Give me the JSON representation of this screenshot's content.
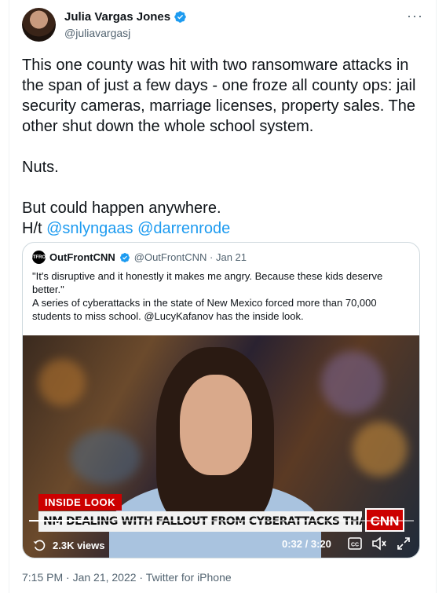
{
  "author": {
    "name": "Julia Vargas Jones",
    "handle": "@juliavargasj",
    "verified": true
  },
  "more_label": "···",
  "tweet": {
    "text_main": "This one county was hit with two ransomware attacks in the span of just a few days - one froze all county ops: jail security cameras, marriage licenses, property sales. The other shut down the whole school system.\n\nNuts.\n\nBut could happen anywhere.\nH/t ",
    "mention1": "@snlyngaas",
    "space": " ",
    "mention2": "@darrenrode"
  },
  "quote": {
    "avatar_text": "OUTFRONT",
    "name": "OutFrontCNN",
    "handle_date": "@OutFrontCNN · Jan 21",
    "text": "\"It's disruptive and it honestly it makes me angry. Because these kids deserve better.\"\nA series of cyberattacks in the state of New Mexico forced more than 70,000 students to miss school. @LucyKafanov has the inside look.",
    "video": {
      "tag": "INSIDE LOOK",
      "headline": "NM DEALING WITH FALLOUT FROM CYBERATTACKS THAT CLOSED SCHOOLS",
      "logo": "CNN",
      "views": "2.3K views",
      "time": "0:32 / 3:20",
      "progress_fraction": 0.16
    }
  },
  "footer": "7:15 PM · Jan 21, 2022 · Twitter for iPhone",
  "colors": {
    "accent": "#1d9bf0",
    "cnn_red": "#cc0000"
  }
}
